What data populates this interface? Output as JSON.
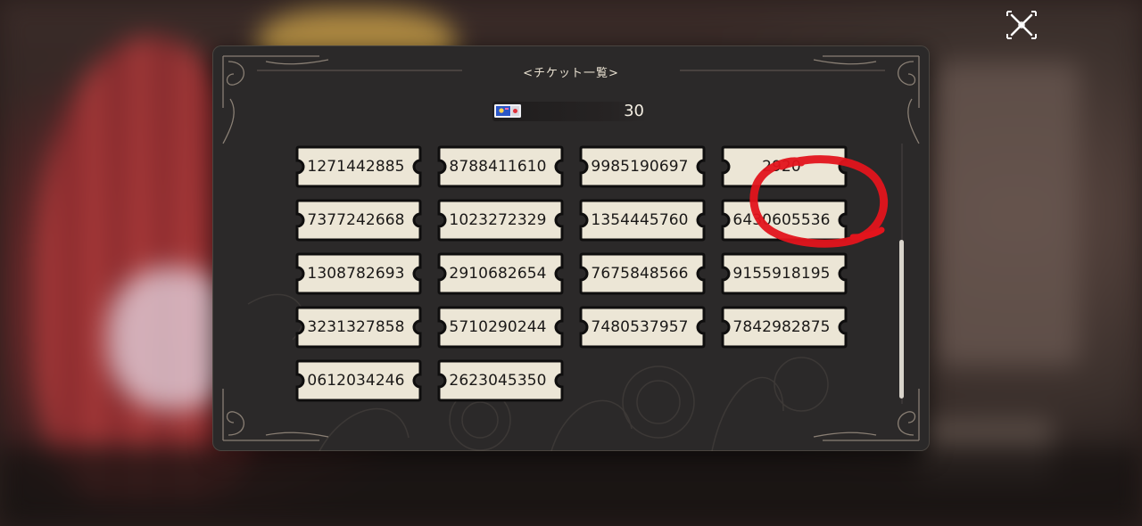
{
  "panel": {
    "title": "<チケット一覧>",
    "ticket_count": "30"
  },
  "tickets": [
    "1271442885",
    "8788411610",
    "9985190697",
    "2920",
    "7377242668",
    "1023272329",
    "1354445760",
    "6430605536",
    "1308782693",
    "2910682654",
    "7675848566",
    "9155918195",
    "3231327858",
    "5710290244",
    "7480537957",
    "7842982875",
    "0612034246",
    "2623045350"
  ],
  "scrollbar": {
    "position": 0.6
  },
  "colors": {
    "panel": "#2b2929",
    "ticket_face": "#ece6d6",
    "ticket_border": "#0f0e0e",
    "annotation": "#e3141c"
  },
  "icons": {
    "close": "close-x-icon",
    "ticket": "ticket-icon"
  }
}
